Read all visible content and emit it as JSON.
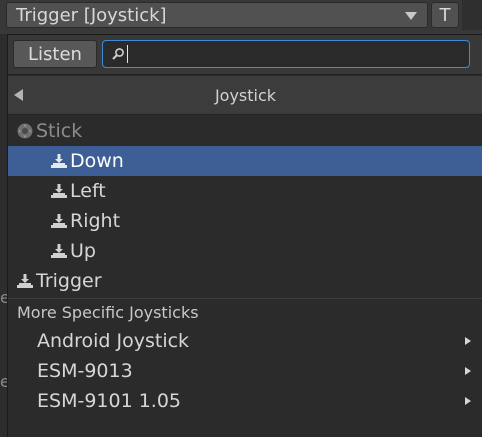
{
  "binding": {
    "label": "Trigger [Joystick]",
    "t_button": "T"
  },
  "search": {
    "listen_label": "Listen",
    "value": ""
  },
  "header": {
    "title": "Joystick"
  },
  "items": [
    {
      "label": "Stick",
      "icon": "stick-icon",
      "state": "disabled"
    },
    {
      "label": "Down",
      "icon": "button-control-icon",
      "state": "selected"
    },
    {
      "label": "Left",
      "icon": "button-control-icon",
      "state": "normal"
    },
    {
      "label": "Right",
      "icon": "button-control-icon",
      "state": "normal"
    },
    {
      "label": "Up",
      "icon": "button-control-icon",
      "state": "normal"
    },
    {
      "label": "Trigger",
      "icon": "button-control-icon",
      "state": "normal"
    }
  ],
  "more": {
    "title": "More Specific Joysticks",
    "devices": [
      "Android Joystick",
      "ESM-9013",
      "ESM-9101 1.05"
    ]
  },
  "background": {
    "left_glyphs": [
      "e",
      "e"
    ]
  }
}
